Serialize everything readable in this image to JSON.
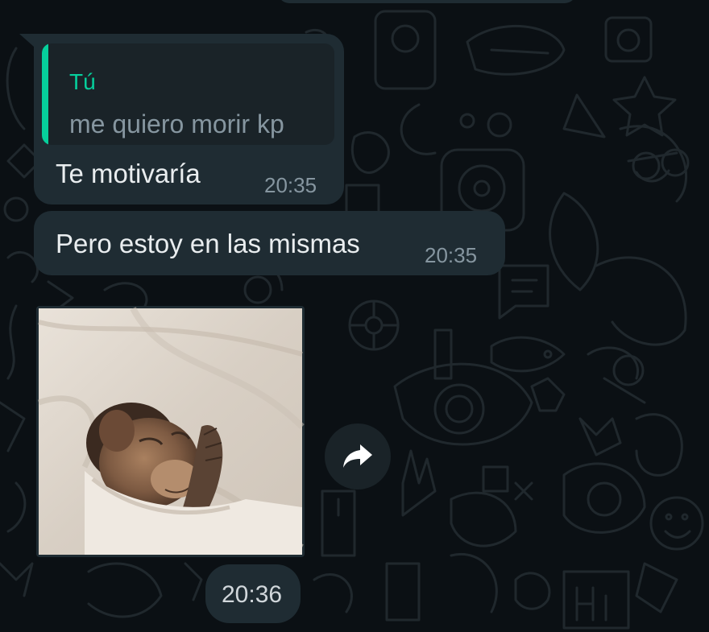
{
  "colors": {
    "background": "#0b1014",
    "bubble": "#1f2c33",
    "quote_accent": "#06cf9c",
    "secondary_text": "#8696a0"
  },
  "messages": [
    {
      "quoted": {
        "author": "Tú",
        "text": "me quiero morir kp"
      },
      "text": "Te motivaría",
      "time": "20:35"
    },
    {
      "text": "Pero estoy en las mismas",
      "time": "20:35"
    }
  ],
  "image_message": {
    "image": "sleeping-monkey-photo",
    "forward_icon": "forward-arrow-icon",
    "time": "20:36"
  }
}
